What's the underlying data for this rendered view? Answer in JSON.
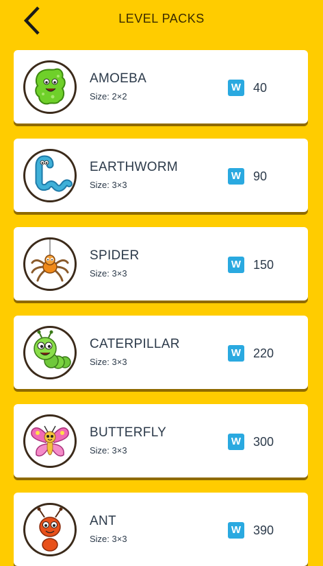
{
  "header": {
    "title": "LEVEL PACKS",
    "back_icon": "chevron-left-icon"
  },
  "colors": {
    "background": "#FFCC00",
    "card": "#FFFFFF",
    "badge": "#2AA9E0",
    "text": "#2C3A4A"
  },
  "packs": [
    {
      "name": "AMOEBA",
      "size": "Size: 2×2",
      "badge": "W",
      "cost": "40",
      "icon": "amoeba-icon"
    },
    {
      "name": "EARTHWORM",
      "size": "Size: 3×3",
      "badge": "W",
      "cost": "90",
      "icon": "earthworm-icon"
    },
    {
      "name": "SPIDER",
      "size": "Size: 3×3",
      "badge": "W",
      "cost": "150",
      "icon": "spider-icon"
    },
    {
      "name": "CATERPILLAR",
      "size": "Size: 3×3",
      "badge": "W",
      "cost": "220",
      "icon": "caterpillar-icon"
    },
    {
      "name": "BUTTERFLY",
      "size": "Size: 3×3",
      "badge": "W",
      "cost": "300",
      "icon": "butterfly-icon"
    },
    {
      "name": "ANT",
      "size": "Size: 3×3",
      "badge": "W",
      "cost": "390",
      "icon": "ant-icon"
    }
  ]
}
